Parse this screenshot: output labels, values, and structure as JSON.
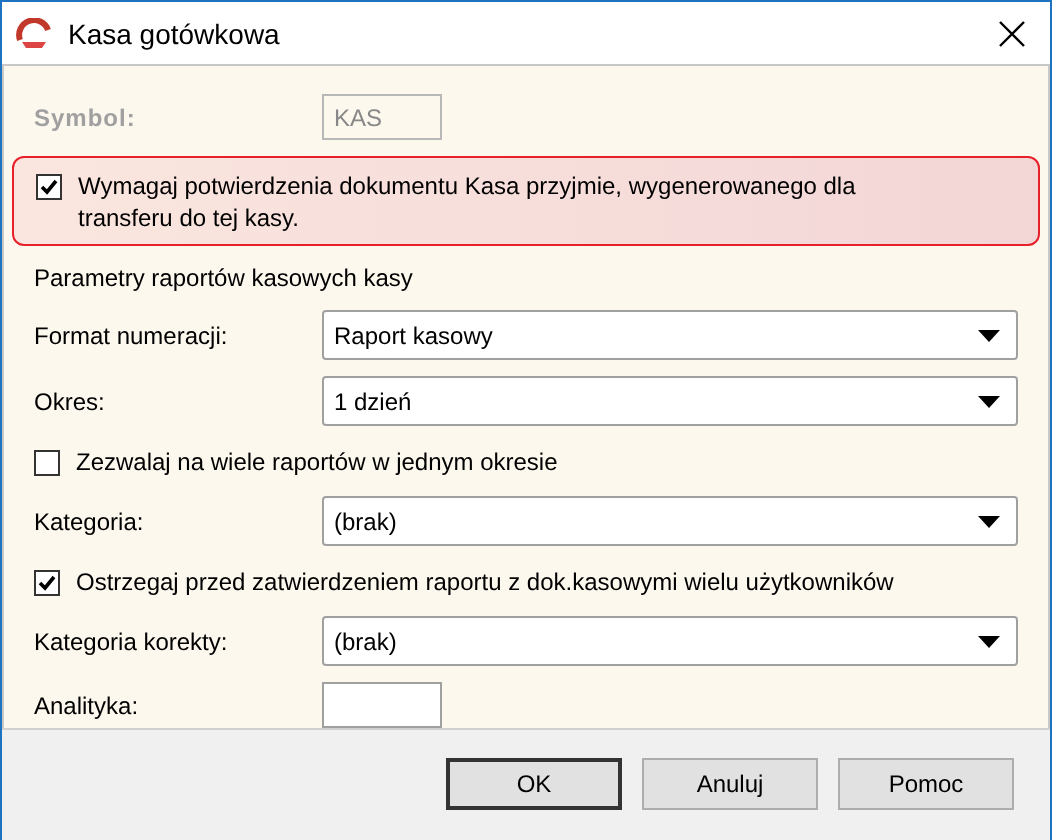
{
  "window": {
    "title": "Kasa gotówkowa"
  },
  "symbol": {
    "label": "Symbol:",
    "value": "KAS",
    "disabled": true
  },
  "confirm_transfer": {
    "label": "Wymagaj potwierdzenia dokumentu Kasa przyjmie, wygenerowanego dla transferu do tej kasy.",
    "checked": true,
    "highlighted": true
  },
  "section_title": "Parametry raportów kasowych kasy",
  "fields": [
    {
      "kind": "combo",
      "label": "Format numeracji:",
      "value": "Raport kasowy"
    },
    {
      "kind": "combo",
      "label": "Okres:",
      "value": "1 dzień"
    },
    {
      "kind": "checkbox",
      "label": "Zezwalaj na wiele raportów w jednym okresie",
      "checked": false
    },
    {
      "kind": "combo",
      "label": "Kategoria:",
      "value": "(brak)"
    },
    {
      "kind": "checkbox",
      "label": "Ostrzegaj przed zatwierdzeniem raportu z dok.kasowymi wielu użytkowników",
      "checked": true
    },
    {
      "kind": "combo",
      "label": "Kategoria korekty:",
      "value": "(brak)"
    },
    {
      "kind": "text",
      "label": "Analityka:"
    }
  ],
  "buttons": [
    {
      "label": "OK",
      "default": true
    },
    {
      "label": "Anuluj",
      "default": false
    },
    {
      "label": "Pomoc",
      "default": false
    }
  ]
}
